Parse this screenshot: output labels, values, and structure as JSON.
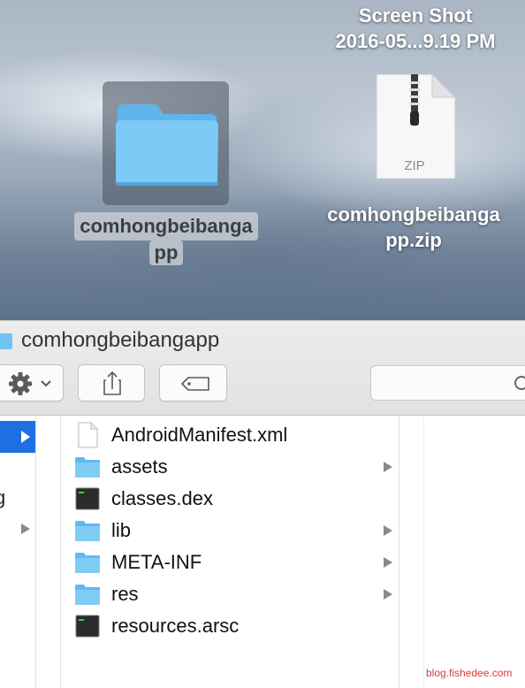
{
  "desktop": {
    "screenshot_label_line1": "Screen Shot",
    "screenshot_label_line2": "2016-05...9.19 PM",
    "folder_label_line1": "comhongbeibanga",
    "folder_label_line2": "pp",
    "zip_badge": "ZIP",
    "zip_label_line1": "comhongbeibanga",
    "zip_label_line2": "pp.zip"
  },
  "window": {
    "title": "comhongbeibangapp"
  },
  "sidebar": {
    "partial_text": "g"
  },
  "files": [
    {
      "name": "AndroidManifest.xml",
      "icon": "document-icon",
      "folder": false
    },
    {
      "name": "assets",
      "icon": "folder-icon",
      "folder": true
    },
    {
      "name": "classes.dex",
      "icon": "exec-icon",
      "folder": false
    },
    {
      "name": "lib",
      "icon": "folder-icon",
      "folder": true
    },
    {
      "name": "META-INF",
      "icon": "folder-icon",
      "folder": true
    },
    {
      "name": "res",
      "icon": "folder-icon",
      "folder": true
    },
    {
      "name": "resources.arsc",
      "icon": "exec-icon",
      "folder": false
    }
  ],
  "watermark": "blog.fishedee.com",
  "colors": {
    "selection": "#1f6fe0",
    "folder": "#6fc3f2",
    "watermark": "#d63a3a"
  }
}
